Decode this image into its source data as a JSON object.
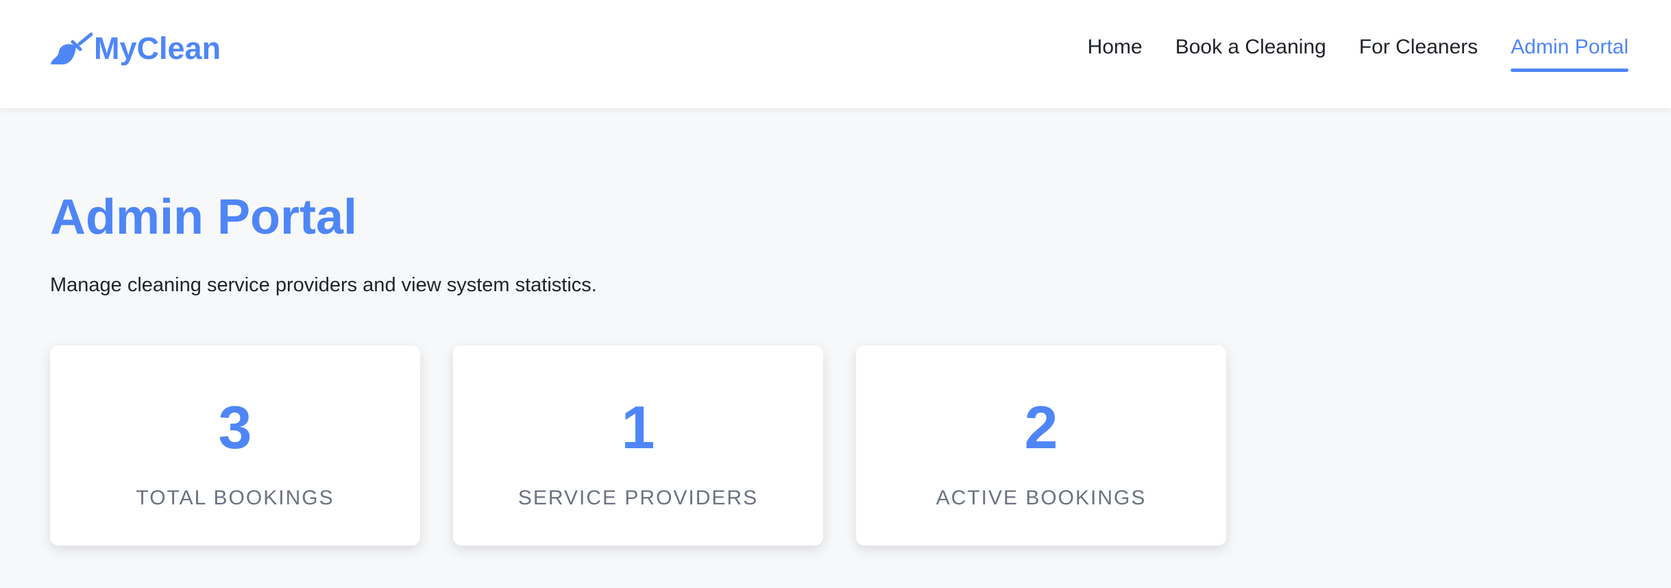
{
  "brand": {
    "name": "MyClean",
    "icon": "broom-icon",
    "color": "#4f86f7"
  },
  "nav": [
    {
      "label": "Home"
    },
    {
      "label": "Book a Cleaning"
    },
    {
      "label": "For Cleaners"
    },
    {
      "label": "Admin Portal",
      "active": true
    }
  ],
  "page": {
    "title": "Admin Portal",
    "subtitle": "Manage cleaning service providers and view system statistics."
  },
  "stats": [
    {
      "value": "3",
      "label": "TOTAL BOOKINGS"
    },
    {
      "value": "1",
      "label": "SERVICE PROVIDERS"
    },
    {
      "value": "2",
      "label": "ACTIVE BOOKINGS"
    }
  ]
}
